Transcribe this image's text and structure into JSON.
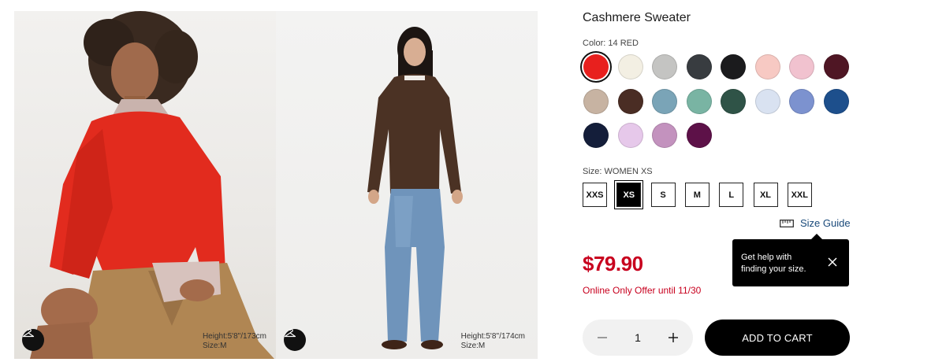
{
  "product": {
    "title": "Cashmere Sweater",
    "color_label": "Color: 14 RED",
    "size_label": "Size: WOMEN XS",
    "price": "$79.90",
    "offer": "Online Only Offer until 11/30"
  },
  "colors": [
    {
      "name": "red",
      "hex": "#e8201e",
      "selected": true
    },
    {
      "name": "off-white",
      "hex": "#f3efe3"
    },
    {
      "name": "light-gray",
      "hex": "#c4c4c2"
    },
    {
      "name": "dark-gray",
      "hex": "#383c40"
    },
    {
      "name": "black",
      "hex": "#1b1b1d"
    },
    {
      "name": "light-pink",
      "hex": "#f7c9c3"
    },
    {
      "name": "pink",
      "hex": "#f1c2cf"
    },
    {
      "name": "wine",
      "hex": "#4f1624"
    },
    {
      "name": "beige",
      "hex": "#c7b3a2"
    },
    {
      "name": "dark-brown",
      "hex": "#4a2d24"
    },
    {
      "name": "blue-gray",
      "hex": "#7aa4b7"
    },
    {
      "name": "mint",
      "hex": "#79b4a3"
    },
    {
      "name": "dark-green",
      "hex": "#2f5347"
    },
    {
      "name": "pale-blue",
      "hex": "#d9e2f1"
    },
    {
      "name": "periwinkle",
      "hex": "#7c92cf"
    },
    {
      "name": "blue",
      "hex": "#1d4f8c"
    },
    {
      "name": "navy",
      "hex": "#141e3a"
    },
    {
      "name": "lavender",
      "hex": "#e6c8ea"
    },
    {
      "name": "mauve",
      "hex": "#c392be"
    },
    {
      "name": "purple",
      "hex": "#5d1148"
    }
  ],
  "sizes": [
    "XXS",
    "XS",
    "S",
    "M",
    "L",
    "XL",
    "XXL"
  ],
  "selected_size": "XS",
  "size_guide": {
    "label": "Size Guide",
    "icon": "ruler-icon"
  },
  "tooltip": {
    "line1": "Get help with",
    "line2": "finding your size."
  },
  "quantity": {
    "value": "1"
  },
  "cart": {
    "label": "ADD TO CART"
  },
  "gallery": [
    {
      "height": "Height:5'8\"/173cm",
      "size": "Size:M"
    },
    {
      "height": "Height:5'8''/174cm",
      "size": "Size:M"
    }
  ],
  "brand_colors": {
    "price_red": "#c8001e",
    "link_blue": "#1a4a7a"
  }
}
